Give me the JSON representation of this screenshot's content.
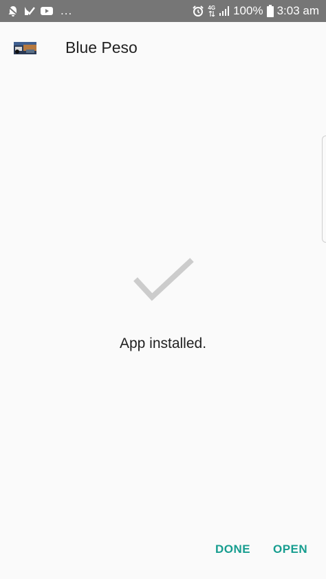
{
  "status_bar": {
    "notification_icons": [
      "bell-icon",
      "check-arrow-icon",
      "youtube-icon"
    ],
    "overflow": "...",
    "network_label": "4G",
    "battery_percent": "100%",
    "time": "3:03 am"
  },
  "app": {
    "name": "Blue Peso"
  },
  "install": {
    "message": "App installed."
  },
  "actions": {
    "done_label": "DONE",
    "open_label": "OPEN"
  },
  "colors": {
    "status_bar_bg": "#767676",
    "background": "#fafafa",
    "accent": "#169d8f",
    "check_mark": "#cccccc"
  }
}
